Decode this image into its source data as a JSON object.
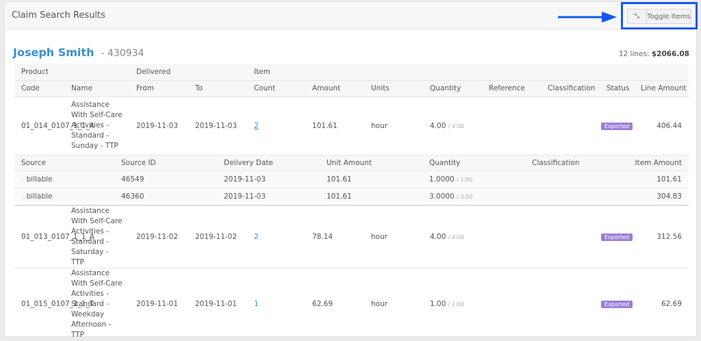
{
  "header": {
    "title": "Claim Search Results",
    "toggle_label": "Toggle Items",
    "toggle_icon": "compress-icon"
  },
  "client": {
    "name": "Joseph Smith",
    "id": "- 430934",
    "lines_label": "12 lines:",
    "total": "$2066.08"
  },
  "groups": [
    "Product",
    "",
    "Delivered",
    "",
    "Item"
  ],
  "columns": [
    "Code",
    "Name",
    "From",
    "To",
    "Count",
    "Amount",
    "Units",
    "Quantity",
    "Reference",
    "Classification",
    "Status",
    "Line Amount"
  ],
  "sub_columns": [
    "Source",
    "Source ID",
    "Delivery Date",
    "Unit Amount",
    "Quantity",
    "Classification",
    "Item Amount"
  ],
  "rows": [
    {
      "code": "01_014_0107_1_1_A",
      "name": "Assistance With Self-Care Activities - Standard - Sunday - TTP",
      "from": "2019-11-03",
      "to": "2019-11-03",
      "count": "2",
      "amount": "101.61",
      "units": "hour",
      "qty": "4.00",
      "qty_sub": "/ 4:00",
      "reference": "",
      "classification": "",
      "status": "Exported",
      "line_amount": "406.44",
      "expanded": true,
      "items": [
        {
          "source": "billable",
          "source_id": "46549",
          "date": "2019-11-03",
          "unit_amount": "101.61",
          "qty": "1.0000",
          "qty_sub": "/ 1:00",
          "classification": "",
          "item_amount": "101.61"
        },
        {
          "source": "billable",
          "source_id": "46360",
          "date": "2019-11-03",
          "unit_amount": "101.61",
          "qty": "3.0000",
          "qty_sub": "/ 3:00",
          "classification": "",
          "item_amount": "304.83"
        }
      ]
    },
    {
      "code": "01_013_0107_1_1_A",
      "name": "Assistance With Self-Care Activities - Standard - Saturday - TTP",
      "from": "2019-11-02",
      "to": "2019-11-02",
      "count": "2",
      "amount": "78.14",
      "units": "hour",
      "qty": "4.00",
      "qty_sub": "/ 4:00",
      "reference": "",
      "classification": "",
      "status": "Exported",
      "line_amount": "312.56",
      "expanded": false,
      "items": []
    },
    {
      "code": "01_015_0107_1_1_T",
      "name": "Assistance With Self-Care Activities - Standard - Weekday Afternoon - TTP",
      "from": "2019-11-01",
      "to": "2019-11-01",
      "count": "1",
      "amount": "62.69",
      "units": "hour",
      "qty": "1.00",
      "qty_sub": "/ 1:00",
      "reference": "",
      "classification": "",
      "status": "Exported",
      "line_amount": "62.69",
      "expanded": false,
      "items": []
    }
  ],
  "colors": {
    "accent": "#3a8fd6",
    "badge": "#9b7fd8",
    "highlight": "#1457f0"
  }
}
